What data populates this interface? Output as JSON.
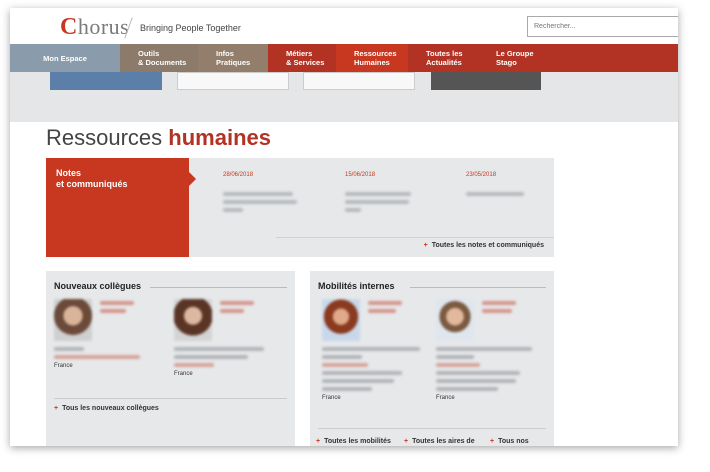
{
  "header": {
    "logo_text": "Chorus",
    "tagline": "Bringing People Together",
    "search_placeholder": "Rechercher..."
  },
  "nav": [
    {
      "label": "Mon Espace"
    },
    {
      "label": "Outils\n& Documents"
    },
    {
      "label": "Infos\nPratiques"
    },
    {
      "label": "Métiers\n& Services"
    },
    {
      "label": "Ressources\nHumaines"
    },
    {
      "label": "Toutes les\nActualités"
    },
    {
      "label": "Le Groupe\nStago"
    }
  ],
  "page": {
    "title_part1": "Ressources ",
    "title_part2": "humaines"
  },
  "notes": {
    "title": "Notes\net communiqués",
    "items": [
      {
        "date": "28/06/2018"
      },
      {
        "date": "15/06/2018"
      },
      {
        "date": "23/05/2018"
      }
    ],
    "all_link": "Toutes les notes et communiqués"
  },
  "new_colleagues": {
    "title": "Nouveaux collègues",
    "people": [
      {
        "country": "France"
      },
      {
        "country": "France"
      }
    ],
    "all_link": "Tous les nouveaux collègues"
  },
  "internal_mobility": {
    "title": "Mobilités internes",
    "people": [
      {
        "country": "France"
      },
      {
        "country": "France"
      }
    ],
    "links": [
      "Toutes les mobilités",
      "Toutes les aires de",
      "Tous nos"
    ]
  },
  "colors": {
    "brand_red": "#c8371f",
    "dark_red": "#b23223",
    "nav_blue_gray": "#8a9bab",
    "nav_brown": "#8c7a6a",
    "panel_gray": "#e6e8ea"
  }
}
